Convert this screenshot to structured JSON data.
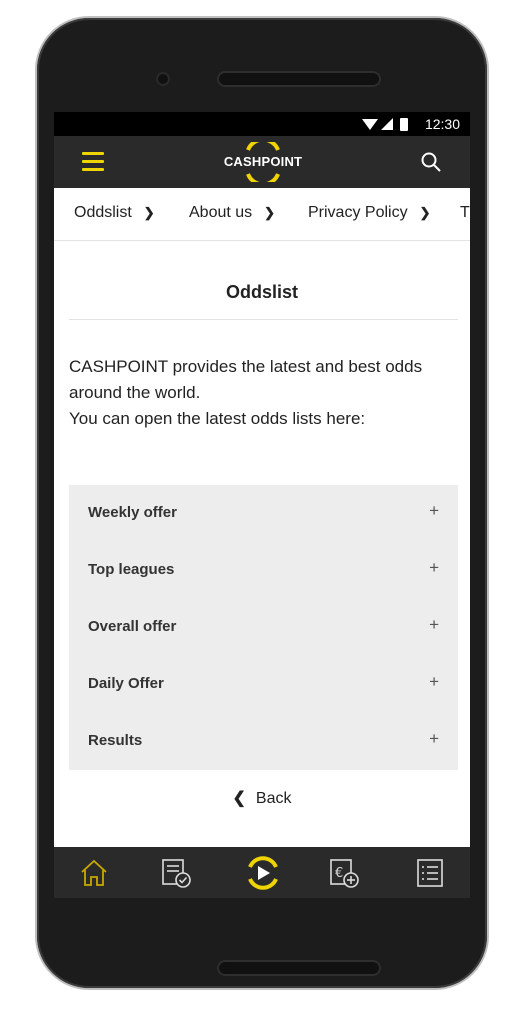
{
  "status": {
    "time": "12:30"
  },
  "app": {
    "brand": "CASHPOINT"
  },
  "breadcrumb": [
    {
      "label": "Oddslist"
    },
    {
      "label": "About us"
    },
    {
      "label": "Privacy Policy"
    },
    {
      "label": "T"
    }
  ],
  "page": {
    "title": "Oddslist",
    "intro_lines": [
      "CASHPOINT provides the latest and best odds",
      "around the world.",
      "You can open the latest odds lists here:"
    ]
  },
  "accordion": [
    {
      "label": "Weekly offer",
      "icon": "+"
    },
    {
      "label": "Top leagues",
      "icon": "+"
    },
    {
      "label": "Overall offer",
      "icon": "+"
    },
    {
      "label": "Daily Offer",
      "icon": "+"
    },
    {
      "label": "Results",
      "icon": "+"
    }
  ],
  "back": {
    "label": "Back"
  },
  "tabbar": {
    "items": [
      {
        "icon": "home-icon",
        "active": true
      },
      {
        "icon": "betslip-check-icon",
        "active": false
      },
      {
        "icon": "live-play-icon",
        "active": false
      },
      {
        "icon": "deposit-euro-icon",
        "active": false
      },
      {
        "icon": "list-icon",
        "active": false
      }
    ]
  },
  "colors": {
    "accent": "#f0d400",
    "appbar": "#2a2a2a",
    "accordion_bg": "#ededed"
  }
}
